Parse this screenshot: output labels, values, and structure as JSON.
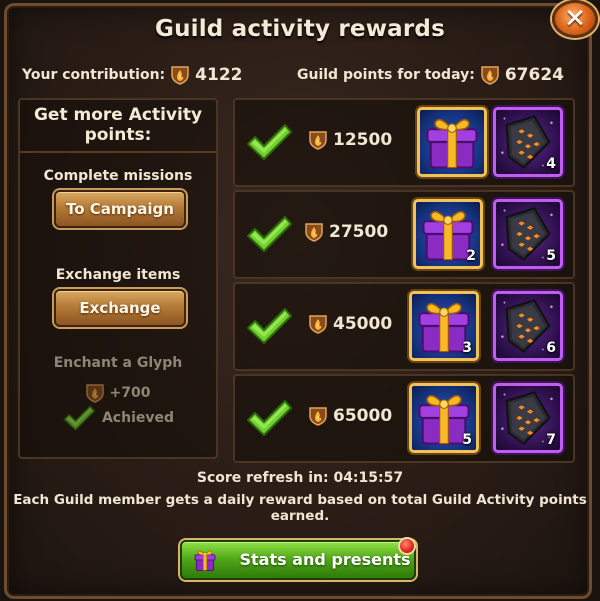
{
  "title": "Guild activity rewards",
  "close_icon": "close-icon",
  "contribution": {
    "label": "Your contribution:",
    "value": "4122"
  },
  "guild_points": {
    "label": "Guild points for today:",
    "value": "67624"
  },
  "left_panel": {
    "heading": "Get more Activity points:",
    "missions": {
      "label": "Complete missions",
      "button": "To Campaign"
    },
    "exchange": {
      "label": "Exchange items",
      "button": "Exchange"
    },
    "glyph": {
      "label": "Enchant a Glyph",
      "bonus": "+700",
      "status": "Achieved"
    }
  },
  "rewards": [
    {
      "points": "12500",
      "gift_count": "",
      "glyph_count": "4"
    },
    {
      "points": "27500",
      "gift_count": "2",
      "glyph_count": "5"
    },
    {
      "points": "45000",
      "gift_count": "3",
      "glyph_count": "6"
    },
    {
      "points": "65000",
      "gift_count": "5",
      "glyph_count": "7"
    }
  ],
  "refresh": "Score refresh in: 04:15:57",
  "info": "Each Guild member gets a daily reward based on total Guild Activity points earned.",
  "stats_button": "Stats and presents",
  "colors": {
    "accent_green": "#4ea418",
    "accent_gold": "#f0c25a",
    "glyph_purple": "#c05df0",
    "check_green": "#6fd22a"
  }
}
